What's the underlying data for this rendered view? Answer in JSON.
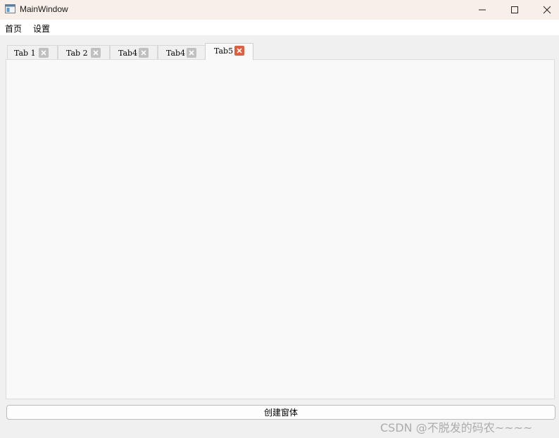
{
  "window": {
    "title": "MainWindow",
    "icon": "window-app-icon",
    "controls": [
      "minimize-icon",
      "maximize-icon",
      "close-icon"
    ]
  },
  "menu": {
    "items": [
      {
        "label": "首页"
      },
      {
        "label": "设置"
      }
    ]
  },
  "tabs": {
    "items": [
      {
        "label": "Tab 1",
        "active": false
      },
      {
        "label": "Tab 2",
        "active": false
      },
      {
        "label": "Tab4",
        "active": false
      },
      {
        "label": "Tab4",
        "active": false
      },
      {
        "label": "Tab5",
        "active": true
      }
    ],
    "close_icon": "close-icon",
    "active_close_color": "#e35d3c",
    "inactive_close_color": "#c0c0c0"
  },
  "actions": {
    "create_window_label": "创建窗体"
  },
  "watermark": {
    "text": "CSDN @不脱发的码农~~~~"
  }
}
